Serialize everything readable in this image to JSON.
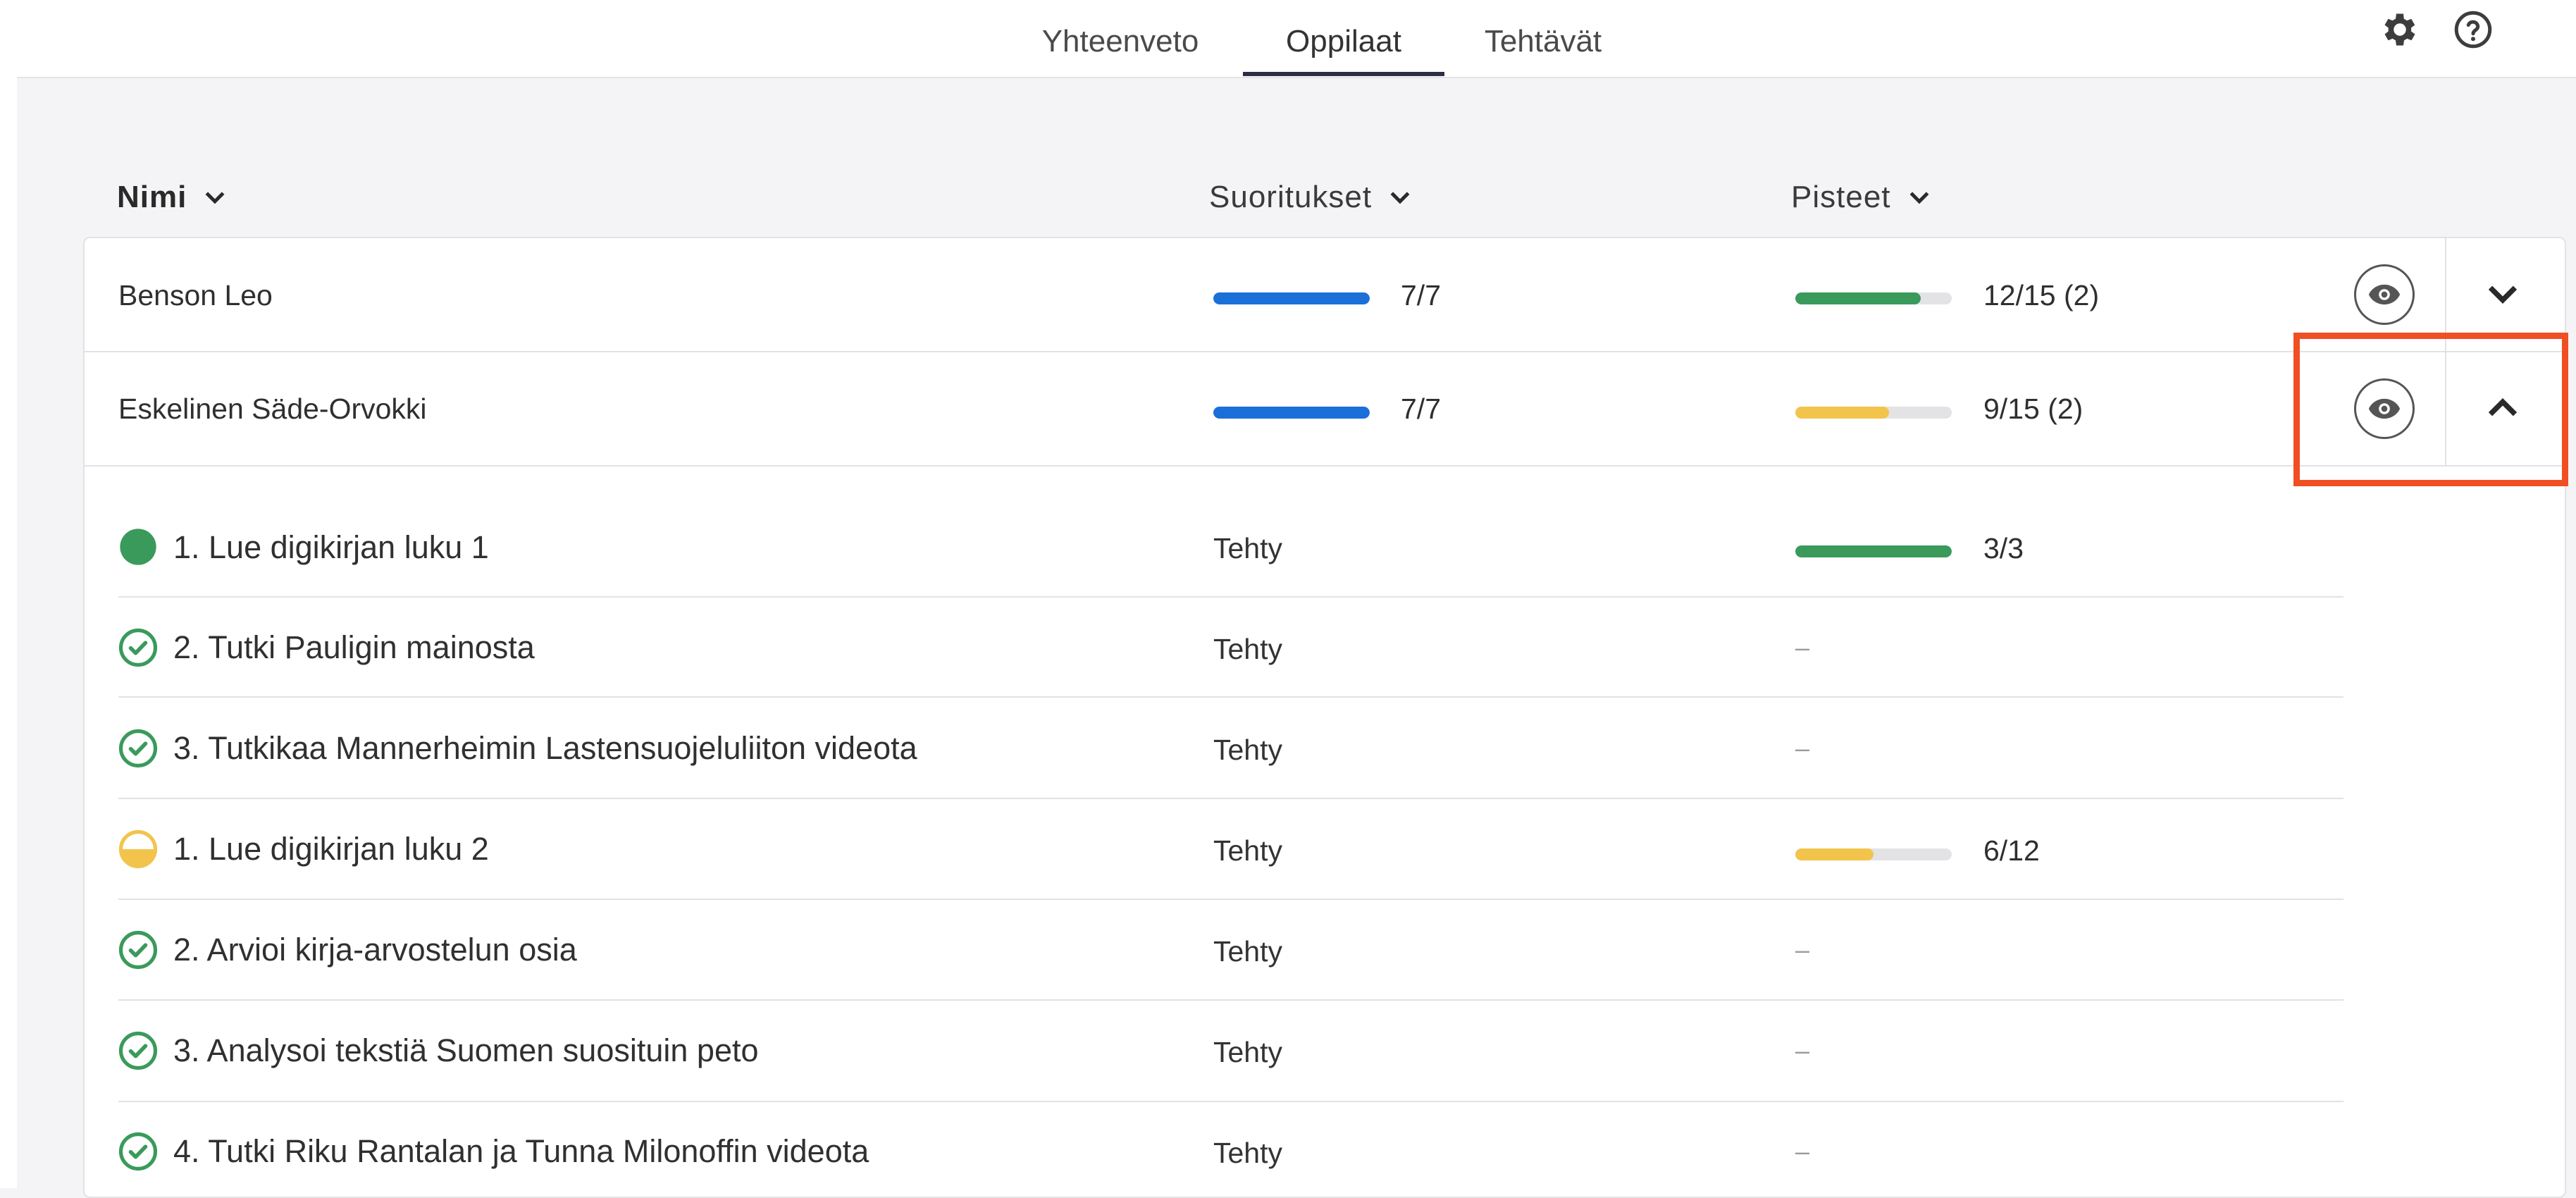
{
  "tabs": [
    {
      "label": "Yhteenveto",
      "active": false
    },
    {
      "label": "Oppilaat",
      "active": true
    },
    {
      "label": "Tehtävät",
      "active": false
    }
  ],
  "top_icons": [
    "gear-icon",
    "help-icon"
  ],
  "columns": {
    "name": "Nimi",
    "completions": "Suoritukset",
    "points": "Pisteet"
  },
  "students": [
    {
      "name": "Benson Leo",
      "completions": "7/7",
      "completion_fraction": 1.0,
      "points": "12/15 (2)",
      "points_fraction": 0.8,
      "points_color": "#3a9a5b",
      "expanded": false
    },
    {
      "name": "Eskelinen Säde-Orvokki",
      "completions": "7/7",
      "completion_fraction": 1.0,
      "points": "9/15 (2)",
      "points_fraction": 0.6,
      "points_color": "#f2c44c",
      "expanded": true
    }
  ],
  "tasks": [
    {
      "title": "1. Lue digikirjan luku 1",
      "status": "Tehty",
      "icon": "filled-circle-icon",
      "points": "3/3",
      "points_fraction": 1.0,
      "points_color": "#3a9a5b"
    },
    {
      "title": "2. Tutki Pauligin mainosta",
      "status": "Tehty",
      "icon": "check-circle-icon",
      "points": "–"
    },
    {
      "title": "3. Tutkikaa Mannerheimin Lastensuojeluliiton videota",
      "status": "Tehty",
      "icon": "check-circle-icon",
      "points": "–"
    },
    {
      "title": "1. Lue digikirjan luku 2",
      "status": "Tehty",
      "icon": "half-circle-icon",
      "points": "6/12",
      "points_fraction": 0.5,
      "points_color": "#f2c44c"
    },
    {
      "title": "2. Arvioi kirja-arvostelun osia",
      "status": "Tehty",
      "icon": "check-circle-icon",
      "points": "–"
    },
    {
      "title": "3. Analysoi tekstiä Suomen suosituin peto",
      "status": "Tehty",
      "icon": "check-circle-icon",
      "points": "–"
    },
    {
      "title": "4. Tutki Riku Rantalan ja Tunna Milonoffin videota",
      "status": "Tehty",
      "icon": "check-circle-icon",
      "points": "–"
    }
  ],
  "colors": {
    "completion_bar": "#1b6fd8",
    "green": "#3a9a5b",
    "yellow": "#f2c44c",
    "highlight": "#f04e23",
    "tab_underline": "#2a2f45"
  }
}
